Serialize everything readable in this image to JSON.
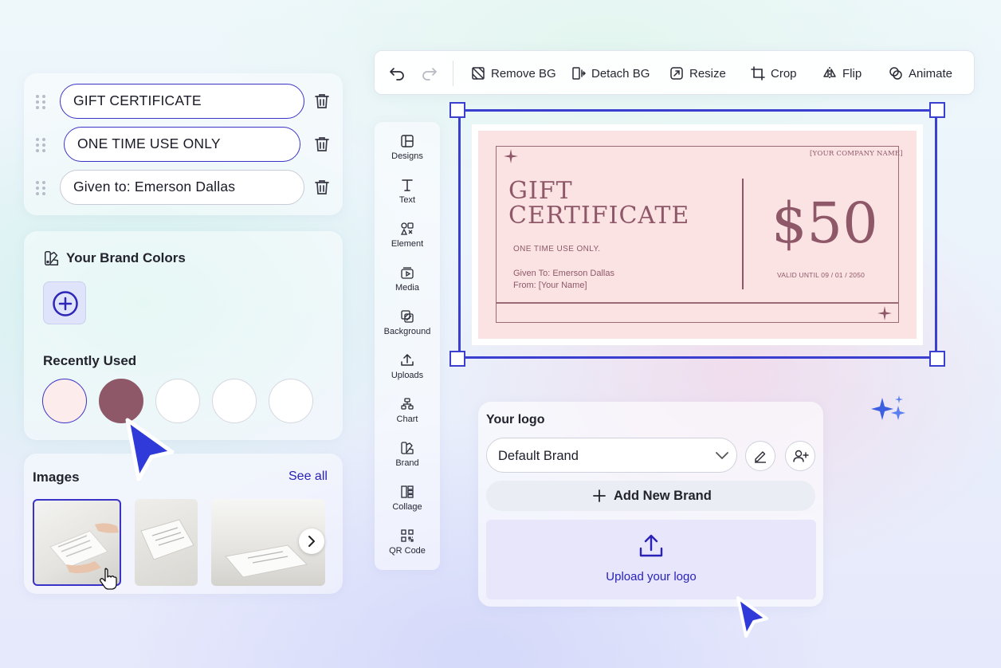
{
  "text_fields": [
    {
      "value": "GIFT CERTIFICATE"
    },
    {
      "value": "ONE TIME USE ONLY"
    },
    {
      "value": "Given to: Emerson Dallas"
    }
  ],
  "brand_colors": {
    "title": "Your Brand Colors",
    "recent_label": "Recently Used",
    "recent": [
      "#fcecec",
      "#8e5868",
      "#ffffff",
      "#ffffff",
      "#ffffff"
    ]
  },
  "images": {
    "title": "Images",
    "see_all": "See all"
  },
  "toolbar": {
    "remove_bg": "Remove BG",
    "detach_bg": "Detach BG",
    "resize": "Resize",
    "crop": "Crop",
    "flip": "Flip",
    "animate": "Animate"
  },
  "side_menu": [
    {
      "label": "Designs",
      "icon": "designs-icon"
    },
    {
      "label": "Text",
      "icon": "text-icon"
    },
    {
      "label": "Element",
      "icon": "element-icon"
    },
    {
      "label": "Media",
      "icon": "media-icon"
    },
    {
      "label": "Background",
      "icon": "background-icon"
    },
    {
      "label": "Uploads",
      "icon": "uploads-icon"
    },
    {
      "label": "Chart",
      "icon": "chart-icon"
    },
    {
      "label": "Brand",
      "icon": "brand-icon"
    },
    {
      "label": "Collage",
      "icon": "collage-icon"
    },
    {
      "label": "QR Code",
      "icon": "qr-code-icon"
    }
  ],
  "certificate": {
    "company": "[YOUR COMPANY NAME]",
    "title_line1": "GIFT",
    "title_line2": "CERTIFICATE",
    "use_note": "ONE TIME USE ONLY.",
    "given_to": "Given To: Emerson Dallas",
    "from": "From: [Your Name]",
    "amount": "$50",
    "valid": "VALID UNTIL 09 / 01 / 2050"
  },
  "logo_panel": {
    "title": "Your logo",
    "brand_select": "Default Brand",
    "add_brand": "Add New Brand",
    "upload": "Upload your logo"
  },
  "colors": {
    "accent": "#3b33c7",
    "certificate_bg": "#fbe3e4",
    "certificate_text": "#8e5868"
  }
}
